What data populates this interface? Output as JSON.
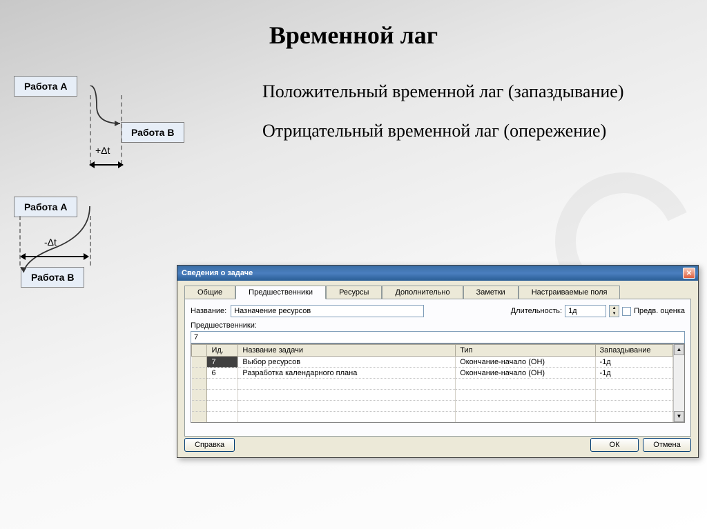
{
  "title": "Временной лаг",
  "text": {
    "positive": "Положительный временной лаг (запаздывание)",
    "negative": "Отрицательный временной лаг (опережение)"
  },
  "diagram1": {
    "boxA": "Работа А",
    "boxB": "Работа В",
    "delta": "+Δt"
  },
  "diagram2": {
    "boxA": "Работа А",
    "boxB": "Работа В",
    "delta": "-Δt"
  },
  "dialog": {
    "title": "Сведения о задаче",
    "tabs": [
      "Общие",
      "Предшественники",
      "Ресурсы",
      "Дополнительно",
      "Заметки",
      "Настраиваемые поля"
    ],
    "activeTab": 1,
    "nameLabel": "Название:",
    "nameValue": "Назначение ресурсов",
    "durationLabel": "Длительность:",
    "durationValue": "1д",
    "estimateLabel": "Предв. оценка",
    "predLabel": "Предшественники:",
    "topValue": "7",
    "columns": {
      "id": "Ид.",
      "name": "Название задачи",
      "type": "Тип",
      "lag": "Запаздывание"
    },
    "rows": [
      {
        "id": "7",
        "name": "Выбор ресурсов",
        "type": "Окончание-начало (ОН)",
        "lag": "-1д",
        "dark": true
      },
      {
        "id": "6",
        "name": "Разработка календарного плана",
        "type": "Окончание-начало (ОН)",
        "lag": "-1д",
        "dark": false
      }
    ],
    "buttons": {
      "help": "Справка",
      "ok": "ОК",
      "cancel": "Отмена"
    }
  }
}
